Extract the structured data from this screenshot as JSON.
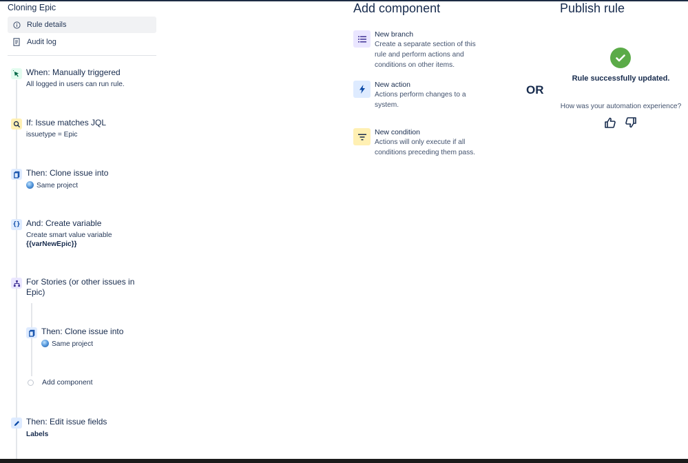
{
  "rule": {
    "title": "Cloning Epic",
    "nav": [
      {
        "label": "Rule details",
        "icon": "info-icon",
        "active": true
      },
      {
        "label": "Audit log",
        "icon": "document-icon",
        "active": false
      }
    ]
  },
  "components": {
    "trigger": {
      "title": "When: Manually triggered",
      "subtitle": "All logged in users can run rule.",
      "icon": "cursor-click-icon",
      "color": "#e3fcef"
    },
    "condition": {
      "title": "If: Issue matches JQL",
      "subtitle": "issuetype = Epic",
      "icon": "search-icon",
      "color": "#fff0b3"
    },
    "clone1": {
      "title": "Then: Clone issue into",
      "subtitle": "Same project",
      "icon": "clone-icon",
      "color": "#deebff"
    },
    "variable": {
      "title": "And: Create variable",
      "subtitle": "Create smart value variable",
      "value": "{{varNewEpic}}",
      "icon": "braces-icon",
      "color": "#deebff"
    },
    "branch": {
      "title": "For Stories (or other issues in",
      "title2": "Epic)",
      "icon": "branch-icon",
      "color": "#eae6ff"
    },
    "clone2": {
      "title": "Then: Clone issue into",
      "subtitle": "Same project",
      "icon": "clone-icon",
      "color": "#deebff"
    },
    "add_component": "Add component",
    "edit": {
      "title": "Then: Edit issue fields",
      "subtitle": "Labels",
      "icon": "pencil-icon",
      "color": "#deebff"
    }
  },
  "add_panel": {
    "heading": "Add component",
    "options": [
      {
        "title": "New branch",
        "desc": "Create a separate section of this rule and perform actions and conditions on other items.",
        "icon": "list-icon",
        "color": "#eae6ff"
      },
      {
        "title": "New action",
        "desc": "Actions perform changes to a system.",
        "icon": "lightning-icon",
        "color": "#deebff"
      },
      {
        "title": "New condition",
        "desc": "Actions will only execute if all conditions preceding them pass.",
        "icon": "filter-icon",
        "color": "#fff0b3"
      }
    ]
  },
  "or_label": "OR",
  "publish": {
    "heading": "Publish rule",
    "success": "Rule successfully updated.",
    "question": "How was your automation experience?",
    "check_color": "#5bab48"
  }
}
